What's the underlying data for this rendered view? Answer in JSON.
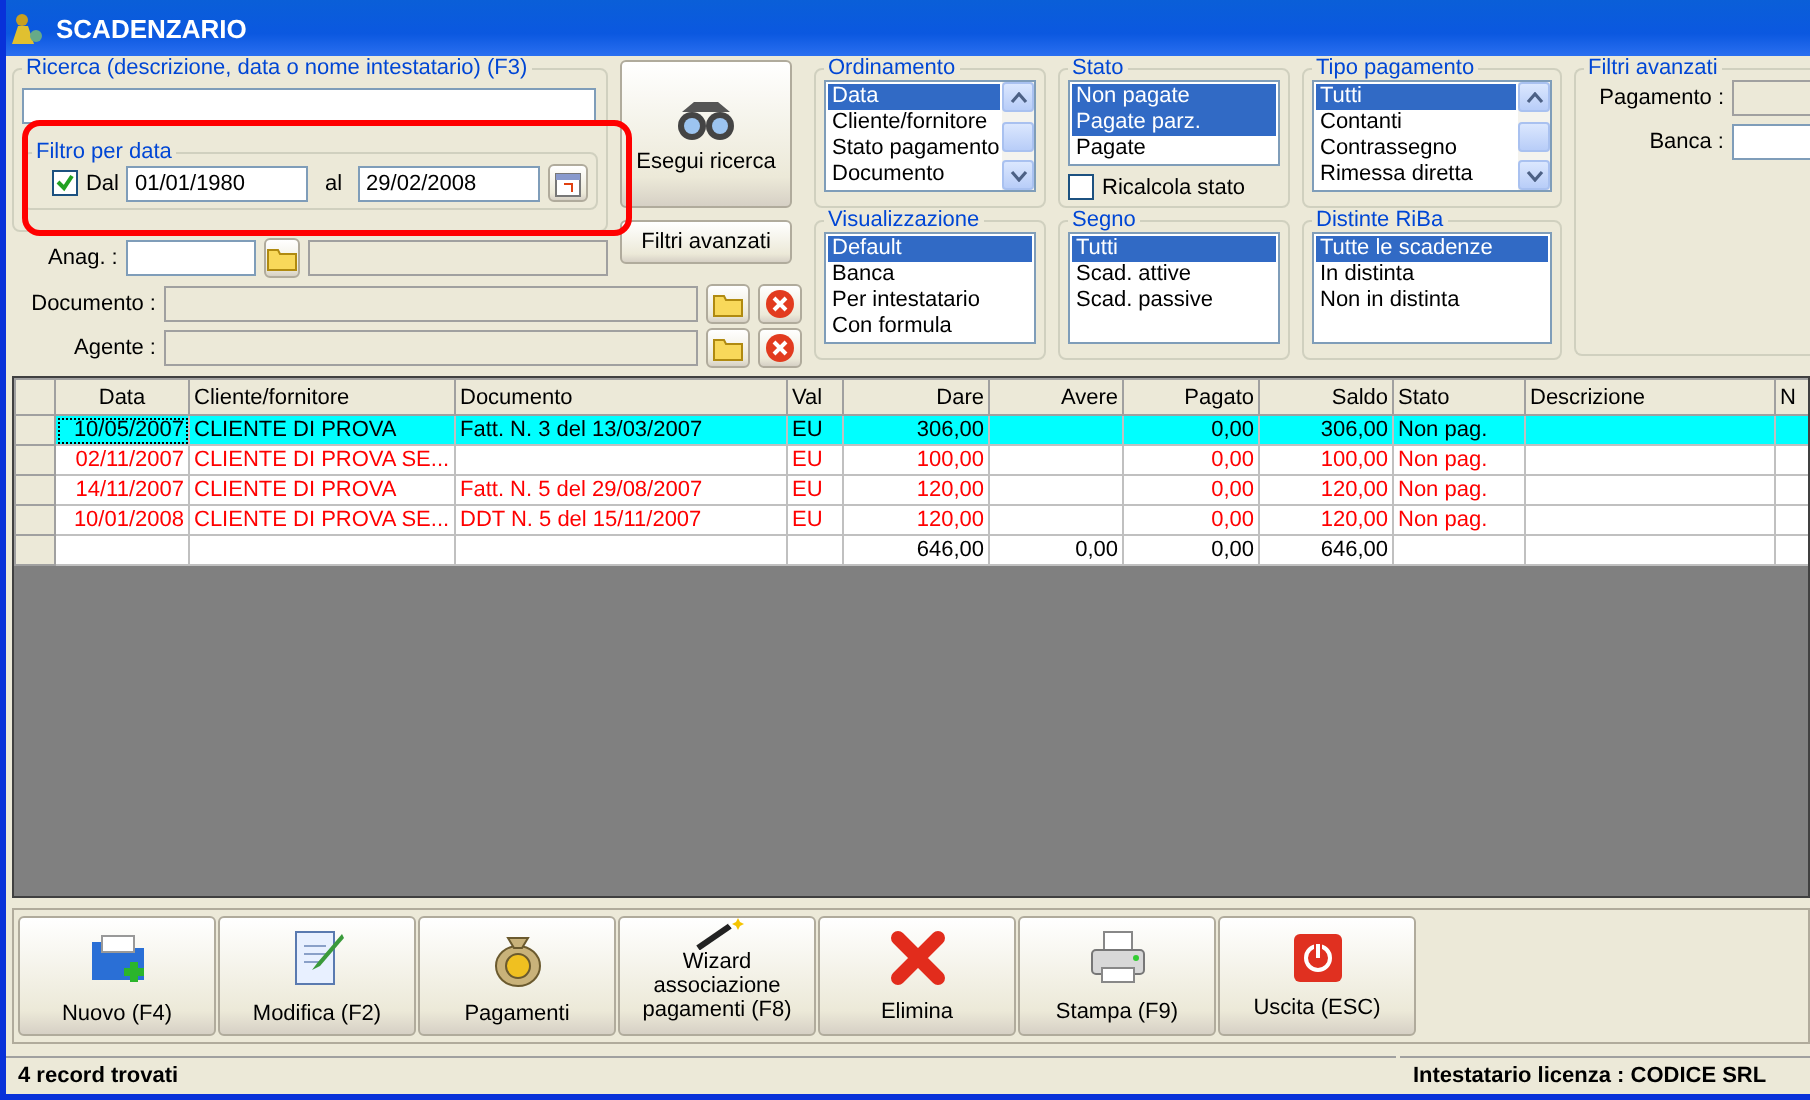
{
  "window": {
    "title": "SCADENZARIO"
  },
  "search": {
    "legend": "Ricerca (descrizione, data o nome intestatario) (F3)"
  },
  "date_filter": {
    "legend": "Filtro per data",
    "checked": true,
    "from_label": "Dal",
    "from": "01/01/1980",
    "to_label": "al",
    "to": "29/02/2008"
  },
  "search_button": "Esegui ricerca",
  "advanced_button": "Filtri avanzati",
  "anag_label": "Anag. :",
  "document_label": "Documento :",
  "agent_label": "Agente :",
  "groups": [
    {
      "legend": "Ordinamento",
      "kind": "scroll",
      "items": [
        {
          "label": "Data",
          "selected": true
        },
        {
          "label": "Cliente/fornitore",
          "selected": false
        },
        {
          "label": "Stato pagamento",
          "selected": false
        },
        {
          "label": "Documento",
          "selected": false
        }
      ]
    },
    {
      "legend": "Stato",
      "kind": "plain",
      "items": [
        {
          "label": "Non pagate",
          "selected": true
        },
        {
          "label": "Pagate parz.",
          "selected": true
        },
        {
          "label": "Pagate",
          "selected": false
        }
      ]
    },
    {
      "legend": "Tipo pagamento",
      "kind": "scroll",
      "items": [
        {
          "label": "Tutti",
          "selected": true
        },
        {
          "label": "Contanti",
          "selected": false
        },
        {
          "label": "Contrassegno",
          "selected": false
        },
        {
          "label": "Rimessa diretta",
          "selected": false
        }
      ]
    },
    {
      "legend": "Visualizzazione",
      "kind": "plain",
      "items": [
        {
          "label": "Default",
          "selected": true
        },
        {
          "label": "Banca",
          "selected": false
        },
        {
          "label": "Per intestatario",
          "selected": false
        },
        {
          "label": "Con formula",
          "selected": false
        }
      ]
    },
    {
      "legend": "Segno",
      "kind": "plain",
      "items": [
        {
          "label": "Tutti",
          "selected": true
        },
        {
          "label": "Scad. attive",
          "selected": false
        },
        {
          "label": "Scad. passive",
          "selected": false
        }
      ]
    },
    {
      "legend": "Distinte RiBa",
      "kind": "plain",
      "items": [
        {
          "label": "Tutte le scadenze",
          "selected": true
        },
        {
          "label": "In distinta",
          "selected": false
        },
        {
          "label": "Non in distinta",
          "selected": false
        }
      ]
    }
  ],
  "recalc": {
    "label": "Ricalcola stato",
    "checked": false
  },
  "advanced_filters": {
    "legend": "Filtri avanzati",
    "payment_label": "Pagamento :",
    "bank_label": "Banca :"
  },
  "table": {
    "columns": [
      "Data",
      "Cliente/fornitore",
      "Documento",
      "Val",
      "Dare",
      "Avere",
      "Pagato",
      "Saldo",
      "Stato",
      "Descrizione",
      "N"
    ],
    "rows": [
      {
        "selected": true,
        "cells": [
          "10/05/2007",
          "CLIENTE DI PROVA",
          "Fatt. N. 3 del 13/03/2007",
          "EU",
          "306,00",
          "",
          "0,00",
          "306,00",
          "Non pag.",
          ""
        ]
      },
      {
        "selected": false,
        "cells": [
          "02/11/2007",
          "CLIENTE DI PROVA SE...",
          "",
          "EU",
          "100,00",
          "",
          "0,00",
          "100,00",
          "Non pag.",
          ""
        ]
      },
      {
        "selected": false,
        "cells": [
          "14/11/2007",
          "CLIENTE DI PROVA",
          "Fatt. N. 5 del 29/08/2007",
          "EU",
          "120,00",
          "",
          "0,00",
          "120,00",
          "Non pag.",
          ""
        ]
      },
      {
        "selected": false,
        "cells": [
          "10/01/2008",
          "CLIENTE DI PROVA SE...",
          "DDT N. 5 del 15/11/2007",
          "EU",
          "120,00",
          "",
          "0,00",
          "120,00",
          "Non pag.",
          ""
        ]
      }
    ],
    "totals": {
      "dare": "646,00",
      "avere": "0,00",
      "pagato": "0,00",
      "saldo": "646,00"
    }
  },
  "toolbar": [
    "Nuovo (F4)",
    "Modifica (F2)",
    "Pagamenti",
    "Wizard associazione pagamenti (F8)",
    "Elimina",
    "Stampa (F9)",
    "Uscita (ESC)"
  ],
  "status_bar": {
    "left": "4 record trovati",
    "right": "Intestatario licenza : CODICE SRL"
  }
}
